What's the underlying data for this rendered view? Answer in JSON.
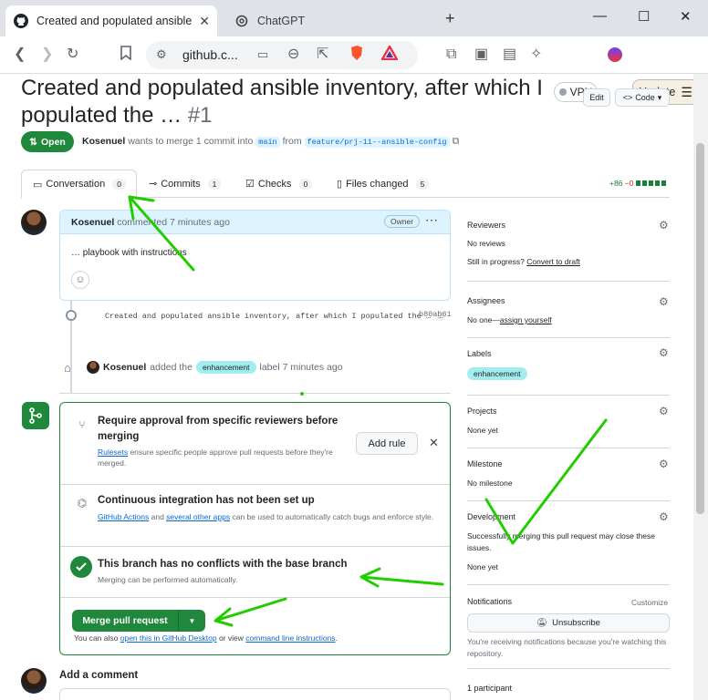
{
  "browser": {
    "tabs": [
      {
        "title": "Created and populated ansible",
        "icon": "github-icon"
      },
      {
        "title": "ChatGPT",
        "icon": "chatgpt-icon"
      }
    ],
    "url": "github.c...",
    "vpn_label": "VPN",
    "update_label": "Update"
  },
  "pr": {
    "title": "Created and populated ansible inventory, after which I populated the …",
    "number": "#1",
    "edit_label": "Edit",
    "code_label": "Code",
    "state": "Open",
    "author": "Kosenuel",
    "merge_text_1": "wants to merge 1 commit into",
    "base_branch": "main",
    "merge_text_2": "from",
    "head_branch": "feature/prj-11--ansible-config"
  },
  "tabs": [
    {
      "label": "Conversation",
      "count": "0"
    },
    {
      "label": "Commits",
      "count": "1"
    },
    {
      "label": "Checks",
      "count": "0"
    },
    {
      "label": "Files changed",
      "count": "5"
    }
  ],
  "diffstat": {
    "added": "+86",
    "removed": "−0"
  },
  "comment": {
    "author": "Kosenuel",
    "action": "commented 7 minutes ago",
    "role": "Owner",
    "body": "… playbook with instructions"
  },
  "commit": {
    "message": "Created and populated ansible inventory, after which I populated the …",
    "ellipsis": "…",
    "sha": "b80ab61"
  },
  "label_event": {
    "actor": "Kosenuel",
    "text_1": "added the",
    "label": "enhancement",
    "text_2": "label 7 minutes ago"
  },
  "merge_box": {
    "approval_title": "Require approval from specific reviewers before merging",
    "approval_link": "Rulesets",
    "approval_desc": "ensure specific people approve pull requests before they're merged.",
    "add_rule": "Add rule",
    "ci_title": "Continuous integration has not been set up",
    "ci_link_1": "GitHub Actions",
    "ci_and": "and",
    "ci_link_2": "several other apps",
    "ci_desc": "can be used to automatically catch bugs and enforce style.",
    "conflict_title": "This branch has no conflicts with the base branch",
    "conflict_desc": "Merging can be performed automatically.",
    "merge_button": "Merge pull request",
    "also_1": "You can also",
    "also_link_1": "open this in GitHub Desktop",
    "also_2": "or view",
    "also_link_2": "command line instructions",
    "also_3": "."
  },
  "add_comment": "Add a comment",
  "sidebar": {
    "reviewers": {
      "heading": "Reviewers",
      "value": "No reviews",
      "progress": "Still in progress?",
      "progress_link": "Convert to draft"
    },
    "assignees": {
      "heading": "Assignees",
      "value": "No one—",
      "link": "assign yourself"
    },
    "labels": {
      "heading": "Labels",
      "value": "enhancement"
    },
    "projects": {
      "heading": "Projects",
      "value": "None yet"
    },
    "milestone": {
      "heading": "Milestone",
      "value": "No milestone"
    },
    "development": {
      "heading": "Development",
      "desc": "Successfully merging this pull request may close these issues.",
      "value": "None yet"
    },
    "notifications": {
      "heading": "Notifications",
      "customize": "Customize",
      "button": "Unsubscribe",
      "desc": "You're receiving notifications because you're watching this repository."
    },
    "participants": "1 participant"
  },
  "annotations": {
    "color": "#22cc00"
  }
}
